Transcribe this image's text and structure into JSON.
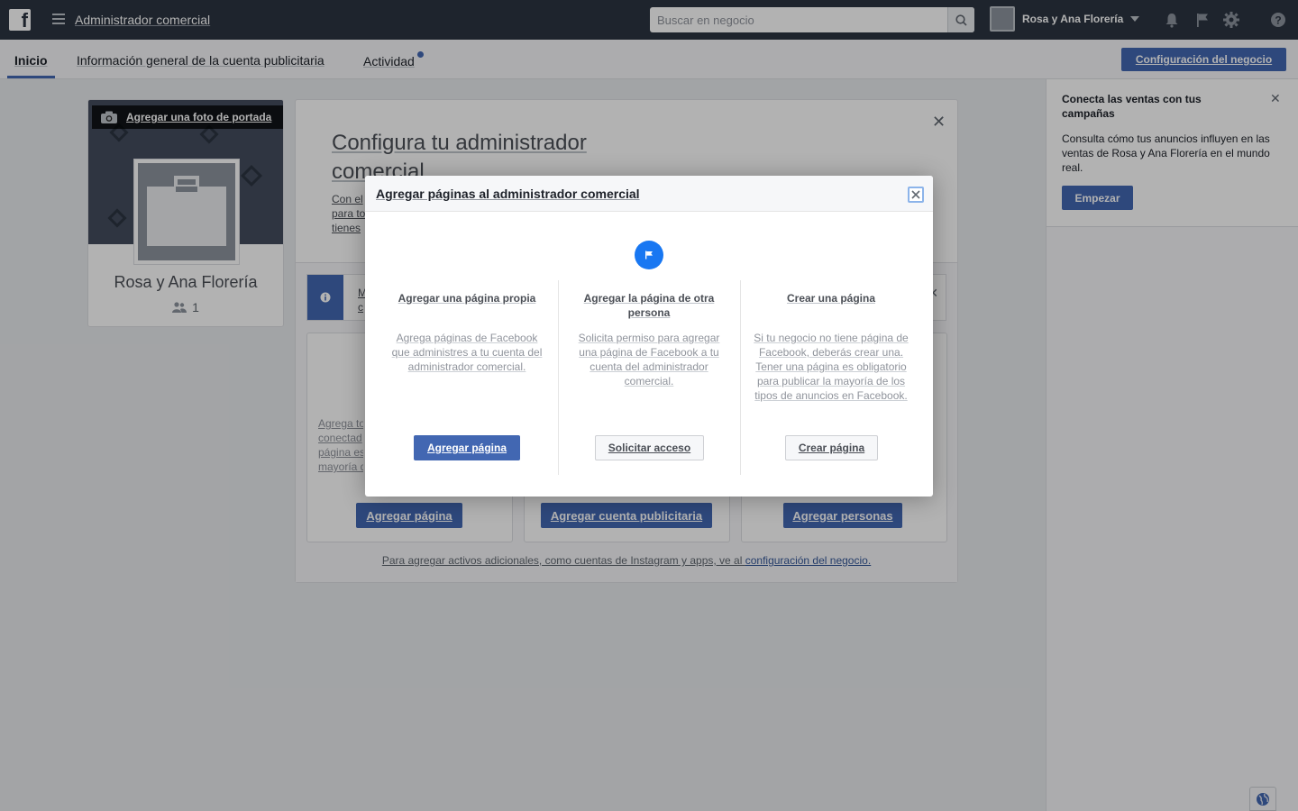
{
  "topbar": {
    "app_title": "Administrador comercial",
    "search_placeholder": "Buscar en negocio",
    "business_name": "Rosa y Ana Florería",
    "icons": [
      "facebook-logo-icon",
      "menu-icon",
      "search-icon",
      "bell-icon",
      "flag-icon",
      "gear-icon",
      "help-icon"
    ]
  },
  "subnav": {
    "tabs": [
      {
        "label": "Inicio",
        "active": true
      },
      {
        "label": "Información general de la cuenta publicitaria",
        "active": false
      },
      {
        "label": "Actividad",
        "active": false
      }
    ],
    "config_button": "Configuración del negocio"
  },
  "profile": {
    "cover_button": "Agregar una foto de portada",
    "name": "Rosa y Ana Florería",
    "people_count": "1"
  },
  "main": {
    "title": "Configura tu administrador comercial",
    "desc_partial": "Con el",
    "desc_line2": "para to",
    "desc_line3": "tienes",
    "info_partial": "M",
    "info_line2": "c",
    "col1_text_lines": [
      "Agrega to",
      "conectad",
      "página es",
      "mayoría d"
    ],
    "buttons": [
      "Agregar página",
      "Agregar cuenta publicitaria",
      "Agregar personas"
    ],
    "footer_text": "Para agregar activos adicionales, como cuentas de Instagram y apps, ve al ",
    "footer_link": "configuración del negocio."
  },
  "right_panel": {
    "title": "Conecta las ventas con tus campañas",
    "text": "Consulta cómo tus anuncios influyen en las ventas de Rosa y Ana Florería en el mundo real.",
    "button": "Empezar"
  },
  "modal": {
    "title": "Agregar páginas al administrador comercial",
    "options": [
      {
        "title": "Agregar una página propia",
        "description": "Agrega páginas de Facebook que administres a tu cuenta del administrador comercial.",
        "button": "Agregar página",
        "style": "primary"
      },
      {
        "title": "Agregar la página de otra persona",
        "description": "Solicita permiso para agregar una página de Facebook a tu cuenta del administrador comercial.",
        "button": "Solicitar acceso",
        "style": "secondary"
      },
      {
        "title": "Crear una página",
        "description": "Si tu negocio no tiene página de Facebook, deberás crear una. Tener una página es obligatorio para publicar la mayoría de los tipos de anuncios en Facebook.",
        "button": "Crear página",
        "style": "secondary"
      }
    ]
  },
  "colors": {
    "topbar_bg": "#2b3441",
    "primary_blue": "#4267b2",
    "icon_blue": "#1877f2"
  }
}
